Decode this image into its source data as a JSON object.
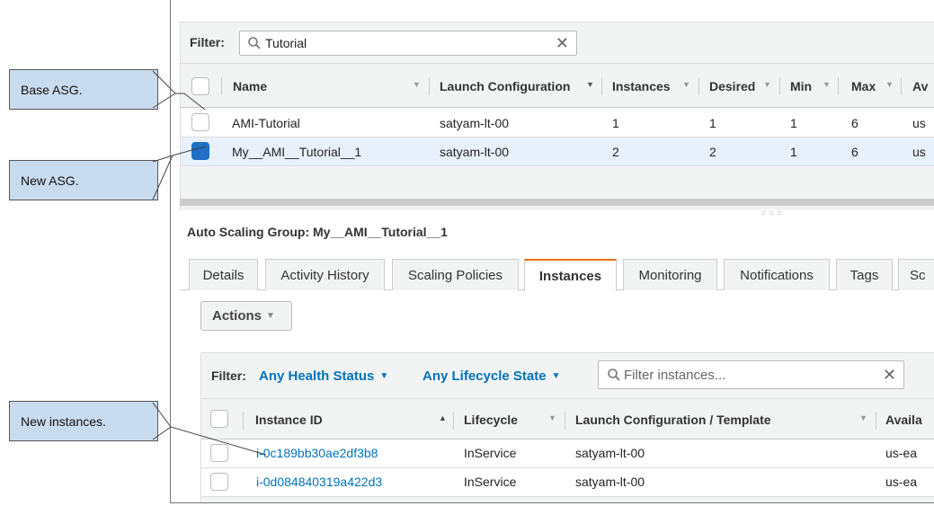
{
  "asg_list": {
    "filter_label": "Filter:",
    "search_value": "Tutorial",
    "columns": [
      "Name",
      "Launch Configuration",
      "Instances",
      "Desired",
      "Min",
      "Max",
      "Av"
    ],
    "rows": [
      {
        "name": "AMI-Tutorial",
        "launch_config": "satyam-lt-00",
        "instances": "1",
        "desired": "1",
        "min": "1",
        "max": "6",
        "az": "us"
      },
      {
        "name": "My__AMI__Tutorial__1",
        "launch_config": "satyam-lt-00",
        "instances": "2",
        "desired": "2",
        "min": "1",
        "max": "6",
        "az": "us"
      }
    ]
  },
  "detail": {
    "title": "Auto Scaling Group: My__AMI__Tutorial__1",
    "tabs": [
      "Details",
      "Activity History",
      "Scaling Policies",
      "Instances",
      "Monitoring",
      "Notifications",
      "Tags",
      "Sc"
    ],
    "active_tab": "Instances",
    "actions_label": "Actions"
  },
  "instances": {
    "filter_label": "Filter:",
    "health_filter": "Any Health Status",
    "lifecycle_filter": "Any Lifecycle State",
    "search_placeholder": "Filter instances...",
    "columns": [
      "Instance ID",
      "Lifecycle",
      "Launch Configuration / Template",
      "Availa"
    ],
    "rows": [
      {
        "id": "i-0c189bb30ae2df3b8",
        "lifecycle": "InService",
        "template": "satyam-lt-00",
        "az": "us-ea"
      },
      {
        "id": "i-0d084840319a422d3",
        "lifecycle": "InService",
        "template": "satyam-lt-00",
        "az": "us-ea"
      }
    ]
  },
  "callouts": {
    "base_asg": "Base ASG.",
    "new_asg": "New ASG.",
    "new_instances": "New instances."
  },
  "colors": {
    "link": "#0073bb",
    "active_tab_accent": "#ec7211",
    "callout_bg": "#c9dbee",
    "selected_row": "#e8f1fb"
  }
}
